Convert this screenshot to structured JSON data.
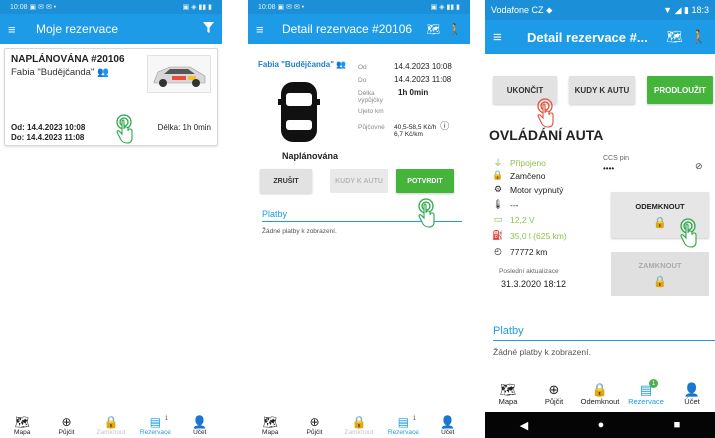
{
  "colors": {
    "primary": "#1e9be6",
    "accent_green": "#44b43a",
    "status_green": "#8bc34a"
  },
  "screen1": {
    "statusbar": {
      "time": "10:08",
      "icons": "▣ ✉ ✉ •",
      "right": "▣ ◈ ▮▮ ▮"
    },
    "appbar": {
      "title": "Moje rezervace",
      "menu_icon": "menu-icon",
      "filter_icon": "filter-icon"
    },
    "reservation": {
      "status": "NAPLÁNOVÁNA #20106",
      "car": "Fabia \"Budějčanda\"",
      "from": "Od: 14.4.2023 10:08",
      "to": "Do: 14.4.2023 11:08",
      "duration": "Délka: 1h 0min"
    },
    "nav": [
      {
        "label": "Mapa",
        "icon": "map-icon"
      },
      {
        "label": "Půjčit",
        "icon": "plus-circle-icon"
      },
      {
        "label": "Zamknout",
        "icon": "lock-icon"
      },
      {
        "label": "Rezervace",
        "icon": "calendar-icon",
        "badge": "1"
      },
      {
        "label": "Účet",
        "icon": "account-icon"
      }
    ]
  },
  "screen2": {
    "statusbar": {
      "time": "10:08",
      "icons": "▣ ✉ ✉ •",
      "right": "▣ ◈ ▮▮ ▮"
    },
    "appbar": {
      "title": "Detail rezervace #20106"
    },
    "car_name": "Fabia \"Budějčanda\"",
    "details": {
      "from_label": "Od",
      "from": "14.4.2023 10:08",
      "to_label": "Do",
      "to": "14.4.2023 11:08",
      "length_label": "Délka výpůjčky",
      "length": "1h 0min",
      "distance_label": "Ujeto km",
      "price_label": "Půjčovné",
      "price1": "40,5-58,5 Kč/h",
      "price2": "6,7 Kč/km"
    },
    "state": "Naplánována",
    "buttons": {
      "cancel": "ZRUŠIT",
      "where": "KUDY K AUTU",
      "confirm": "POTVRDIT"
    },
    "payments_title": "Platby",
    "payments_empty": "Žádné platby k zobrazení.",
    "nav": [
      {
        "label": "Mapa"
      },
      {
        "label": "Půjčit"
      },
      {
        "label": "Zamknout"
      },
      {
        "label": "Rezervace",
        "badge": "1"
      },
      {
        "label": "Účet"
      }
    ]
  },
  "screen3": {
    "statusbar": {
      "carrier": "Vodafone CZ",
      "time": "18:3"
    },
    "appbar": {
      "title": "Detail rezervace #..."
    },
    "buttons": {
      "end": "UKONČIT",
      "where": "KUDY K AUTU",
      "extend": "PRODLOUŽIT"
    },
    "control_title": "OVLÁDÁNÍ AUTA",
    "statuses": {
      "connected": "Připojeno",
      "locked": "Zamčeno",
      "engine": "Motor vypnutý",
      "temp": "---",
      "voltage": "12,2 V",
      "fuel": "35,0 l (625 km)",
      "odometer": "77772 km"
    },
    "ccs_label": "CCS pin",
    "ccs_value": "••••",
    "unlock": "ODEMKNOUT",
    "lock": "ZAMKNOUT",
    "last_update_label": "Poslední aktualizace",
    "last_update": "31.3.2020 18:12",
    "payments_title": "Platby",
    "payments_empty": "Žádné platby k zobrazení.",
    "nav": [
      {
        "label": "Mapa"
      },
      {
        "label": "Půjčit"
      },
      {
        "label": "Odemknout"
      },
      {
        "label": "Rezervace",
        "badge": "1"
      },
      {
        "label": "Účet"
      }
    ]
  }
}
